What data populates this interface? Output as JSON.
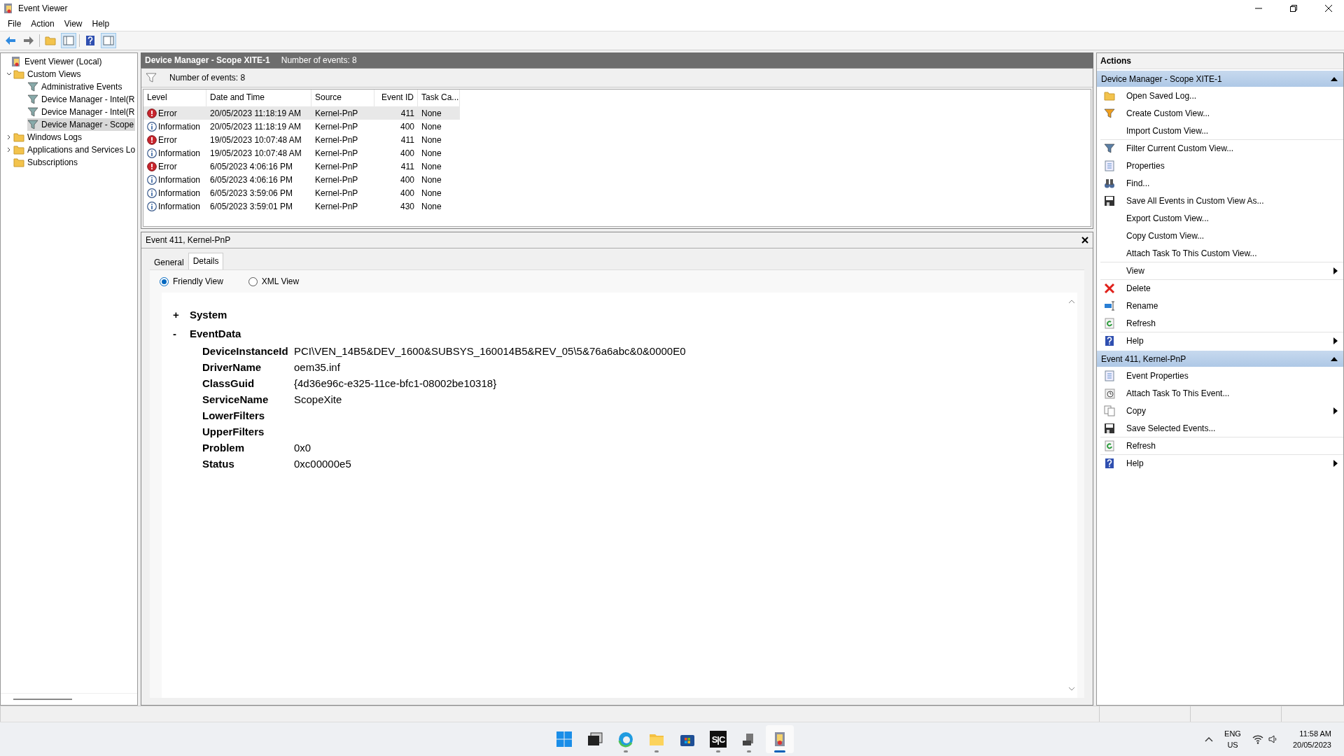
{
  "window": {
    "title": "Event Viewer"
  },
  "menu": [
    "File",
    "Action",
    "View",
    "Help"
  ],
  "tree": [
    {
      "label": "Event Viewer (Local)",
      "selected": false,
      "children": [
        {
          "label": "Custom Views",
          "expanded": true,
          "selected": false,
          "children": [
            {
              "label": "Administrative Events",
              "selected": false
            },
            {
              "label": "Device Manager - Intel(R",
              "selected": false
            },
            {
              "label": "Device Manager - Intel(R",
              "selected": false
            },
            {
              "label": "Device Manager - Scope",
              "selected": true
            }
          ]
        },
        {
          "label": "Windows Logs",
          "expanded": false,
          "selected": false
        },
        {
          "label": "Applications and Services Lo",
          "expanded": false,
          "selected": false
        },
        {
          "label": "Subscriptions",
          "selected": false
        }
      ]
    }
  ],
  "view_header": {
    "title": "Device Manager - Scope XITE-1",
    "count": "Number of events: 8"
  },
  "filter_bar": {
    "text": "Number of events: 8"
  },
  "table": {
    "columns": [
      "Level",
      "Date and Time",
      "Source",
      "Event ID",
      "Task Ca..."
    ],
    "rows": [
      {
        "kind": "error",
        "level": "Error",
        "date": "20/05/2023 11:18:19 AM",
        "source": "Kernel-PnP",
        "event_id": "411",
        "task": "None",
        "selected": true
      },
      {
        "kind": "information",
        "level": "Information",
        "date": "20/05/2023 11:18:19 AM",
        "source": "Kernel-PnP",
        "event_id": "400",
        "task": "None",
        "selected": false
      },
      {
        "kind": "error",
        "level": "Error",
        "date": "19/05/2023 10:07:48 AM",
        "source": "Kernel-PnP",
        "event_id": "411",
        "task": "None",
        "selected": false
      },
      {
        "kind": "information",
        "level": "Information",
        "date": "19/05/2023 10:07:48 AM",
        "source": "Kernel-PnP",
        "event_id": "400",
        "task": "None",
        "selected": false
      },
      {
        "kind": "error",
        "level": "Error",
        "date": "6/05/2023 4:06:16 PM",
        "source": "Kernel-PnP",
        "event_id": "411",
        "task": "None",
        "selected": false
      },
      {
        "kind": "information",
        "level": "Information",
        "date": "6/05/2023 4:06:16 PM",
        "source": "Kernel-PnP",
        "event_id": "400",
        "task": "None",
        "selected": false
      },
      {
        "kind": "information",
        "level": "Information",
        "date": "6/05/2023 3:59:06 PM",
        "source": "Kernel-PnP",
        "event_id": "400",
        "task": "None",
        "selected": false
      },
      {
        "kind": "information",
        "level": "Information",
        "date": "6/05/2023 3:59:01 PM",
        "source": "Kernel-PnP",
        "event_id": "430",
        "task": "None",
        "selected": false
      }
    ]
  },
  "detail": {
    "title": "Event 411, Kernel-PnP",
    "tabs": [
      {
        "label": "General",
        "selected": false
      },
      {
        "label": "Details",
        "selected": true
      }
    ],
    "views": [
      {
        "label": "Friendly View",
        "selected": true
      },
      {
        "label": "XML View",
        "selected": false
      }
    ],
    "sections": [
      {
        "toggle": "+",
        "title": "System"
      },
      {
        "toggle": "-",
        "title": "EventData",
        "fields": [
          {
            "name": "DeviceInstanceId",
            "value": "PCI\\VEN_14B5&DEV_1600&SUBSYS_160014B5&REV_05\\5&76a6abc&0&0000E0"
          },
          {
            "name": "DriverName",
            "value": "oem35.inf"
          },
          {
            "name": "ClassGuid",
            "value": "{4d36e96c-e325-11ce-bfc1-08002be10318}"
          },
          {
            "name": "ServiceName",
            "value": "ScopeXite"
          },
          {
            "name": "LowerFilters"
          },
          {
            "name": "UpperFilters"
          },
          {
            "name": "Problem",
            "value": "0x0"
          },
          {
            "name": "Status",
            "value": "0xc00000e5"
          }
        ]
      }
    ]
  },
  "actions": {
    "title": "Actions",
    "sections": [
      {
        "title": "Device Manager - Scope XITE-1",
        "expanded": true,
        "items": [
          {
            "label": "Open Saved Log..."
          },
          {
            "label": "Create Custom View..."
          },
          {
            "label": "Import Custom View..."
          },
          {
            "label": "Filter Current Custom View...",
            "separator_before": true
          },
          {
            "label": "Properties"
          },
          {
            "label": "Find..."
          },
          {
            "label": "Save All Events in Custom View As..."
          },
          {
            "label": "Export Custom View..."
          },
          {
            "label": "Copy Custom View..."
          },
          {
            "label": "Attach Task To This Custom View..."
          },
          {
            "label": "View",
            "separator_before": true,
            "submenu": true
          },
          {
            "label": "Delete",
            "separator_before": true
          },
          {
            "label": "Rename"
          },
          {
            "label": "Refresh"
          },
          {
            "label": "Help",
            "separator_before": true,
            "submenu": true
          }
        ]
      },
      {
        "title": "Event 411, Kernel-PnP",
        "expanded": true,
        "items": [
          {
            "label": "Event Properties"
          },
          {
            "label": "Attach Task To This Event..."
          },
          {
            "label": "Copy",
            "submenu": true
          },
          {
            "label": "Save Selected Events..."
          },
          {
            "label": "Refresh",
            "separator_before": true
          },
          {
            "label": "Help",
            "separator_before": true,
            "submenu": true
          }
        ]
      }
    ]
  },
  "taskbar": {
    "apps": [
      {
        "kind": "start",
        "running": false,
        "active": false
      },
      {
        "kind": "taskview",
        "running": false,
        "active": false
      },
      {
        "kind": "edge",
        "running": true,
        "active": false
      },
      {
        "kind": "explorer",
        "running": true,
        "active": false
      },
      {
        "kind": "store",
        "running": false,
        "active": false
      },
      {
        "kind": "sc",
        "label": "S|C",
        "running": true,
        "active": false
      },
      {
        "kind": "device",
        "running": true,
        "active": false
      },
      {
        "kind": "eventviewer",
        "running": true,
        "active": true
      }
    ],
    "language": "ENG",
    "region": "US",
    "time": "11:58 AM",
    "date": "20/05/2023"
  }
}
